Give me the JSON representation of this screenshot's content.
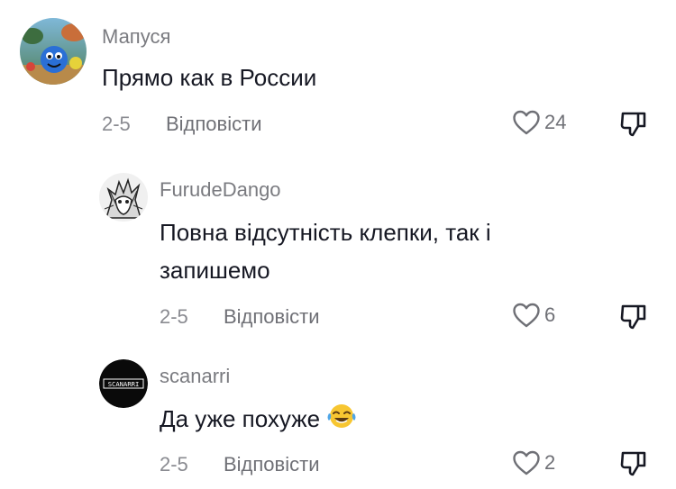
{
  "comments": [
    {
      "username": "Мапуся",
      "text": "Прямо как в России",
      "date": "2-5",
      "reply_label": "Відповісти",
      "likes": "24",
      "avatar": "cartoon-avatar"
    },
    {
      "username": "FurudeDango",
      "text_line1": "Повна відсутність клепки, так і",
      "text_line2": "запишемо",
      "date": "2-5",
      "reply_label": "Відповісти",
      "likes": "6",
      "avatar": "sketch-avatar"
    },
    {
      "username": "scanarri",
      "text": "Да уже похуже",
      "emoji": "face-with-tears-of-joy",
      "date": "2-5",
      "reply_label": "Відповісти",
      "likes": "2",
      "avatar": "logo-avatar",
      "avatar_logo_text": "SCANARRI"
    }
  ],
  "icons": {
    "like": "heart-outline-icon",
    "dislike": "thumb-down-icon"
  },
  "colors": {
    "text": "#161823",
    "muted": "#8a8b91",
    "username": "#7a7b80"
  }
}
